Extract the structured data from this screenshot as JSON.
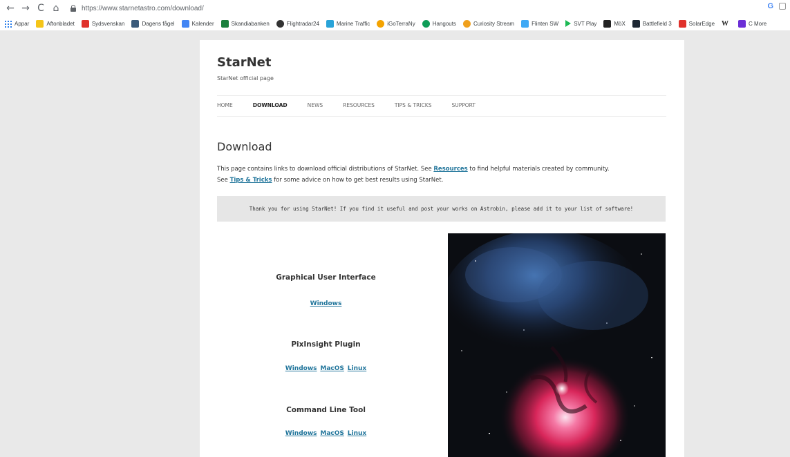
{
  "browser": {
    "url": "https://www.starnetastro.com/download/",
    "nav": [
      "←",
      "→",
      "C",
      "⌂"
    ],
    "bookmarks": [
      {
        "label": "Appar",
        "icon": "apps-grid-icon",
        "color": "#1a73e8"
      },
      {
        "label": "Aftonbladet",
        "icon": "aftonbladet-icon",
        "color": "#f5c518"
      },
      {
        "label": "Sydsvenskan",
        "icon": "sydsvenskan-icon",
        "color": "#e0312b"
      },
      {
        "label": "Dagens fågel",
        "icon": "bird-icon",
        "color": "#3a5a7a"
      },
      {
        "label": "Kalender",
        "icon": "calendar-icon",
        "color": "#4285f4"
      },
      {
        "label": "Skandiabanken",
        "icon": "bank-icon",
        "color": "#1a7f3c"
      },
      {
        "label": "Flightradar24",
        "icon": "radar-icon",
        "color": "#333333"
      },
      {
        "label": "Marine Traffic",
        "icon": "ship-icon",
        "color": "#29a3d8"
      },
      {
        "label": "iGoTerraNy",
        "icon": "igoterra-icon",
        "color": "#f4a300"
      },
      {
        "label": "Hangouts",
        "icon": "hangouts-icon",
        "color": "#0f9d58"
      },
      {
        "label": "Curiosity Stream",
        "icon": "curiosity-icon",
        "color": "#f0a01c"
      },
      {
        "label": "Flinten SW",
        "icon": "flinten-icon",
        "color": "#3fa9f5"
      },
      {
        "label": "SVT Play",
        "icon": "play-icon",
        "color": "#1db954"
      },
      {
        "label": "MöX",
        "icon": "binoculars-icon",
        "color": "#222222"
      },
      {
        "label": "Battlefield 3",
        "icon": "battlefield-icon",
        "color": "#1d2733"
      },
      {
        "label": "SolarEdge",
        "icon": "solaredge-icon",
        "color": "#e0312b"
      },
      {
        "label": "",
        "icon": "wikipedia-icon",
        "color": "#222222"
      },
      {
        "label": "C More",
        "icon": "cmore-icon",
        "color": "#6b2fd6"
      }
    ]
  },
  "site": {
    "title": "StarNet",
    "tagline": "StarNet official page",
    "menu": [
      {
        "label": "HOME",
        "active": false
      },
      {
        "label": "DOWNLOAD",
        "active": true
      },
      {
        "label": "NEWS",
        "active": false
      },
      {
        "label": "RESOURCES",
        "active": false
      },
      {
        "label": "TIPS & TRICKS",
        "active": false
      },
      {
        "label": "SUPPORT",
        "active": false
      }
    ]
  },
  "content": {
    "heading": "Download",
    "intro": {
      "p1_pre": "This page contains links to download official distributions of StarNet. See ",
      "p1_link": "Resources",
      "p1_post": " to find helpful materials created by community.",
      "p2_pre": "See ",
      "p2_link": "Tips & Tricks",
      "p2_post": " for some advice on how to get best results using StarNet."
    },
    "notice": "Thank you for using StarNet! If you find it useful and post your works on Astrobin, please add it to your list of software!",
    "sections": [
      {
        "title": "Graphical User Interface",
        "links": [
          "Windows"
        ]
      },
      {
        "title": "PixInsight Plugin",
        "links": [
          "Windows",
          "MacOS",
          "Linux"
        ]
      },
      {
        "title": "Command Line Tool",
        "links": [
          "Windows",
          "MacOS",
          "Linux"
        ]
      }
    ]
  }
}
